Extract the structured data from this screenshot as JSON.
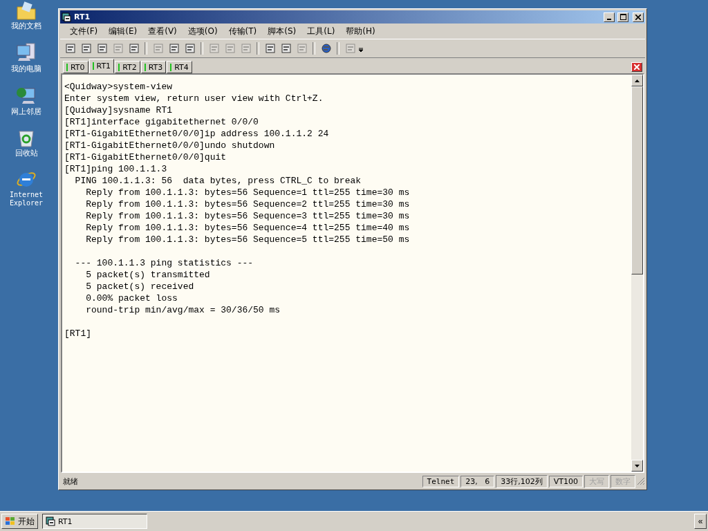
{
  "desktop_icons": [
    {
      "label": "我的文档",
      "kind": "folder"
    },
    {
      "label": "我的电脑",
      "kind": "computer"
    },
    {
      "label": "网上邻居",
      "kind": "network"
    },
    {
      "label": "回收站",
      "kind": "recycle"
    },
    {
      "label": "Internet\nExplorer",
      "kind": "browser"
    }
  ],
  "window": {
    "title": "RT1"
  },
  "menu": [
    "文件(F)",
    "编辑(E)",
    "查看(V)",
    "选项(O)",
    "传输(T)",
    "脚本(S)",
    "工具(L)",
    "帮助(H)"
  ],
  "toolbar": [
    {
      "kind": "button",
      "disabled": false
    },
    {
      "kind": "button",
      "disabled": false
    },
    {
      "kind": "button",
      "disabled": false
    },
    {
      "kind": "button",
      "disabled": true
    },
    {
      "kind": "button",
      "disabled": false
    },
    {
      "kind": "separator"
    },
    {
      "kind": "button",
      "disabled": true
    },
    {
      "kind": "button",
      "disabled": false
    },
    {
      "kind": "button",
      "disabled": false
    },
    {
      "kind": "separator"
    },
    {
      "kind": "button",
      "disabled": true
    },
    {
      "kind": "button",
      "disabled": true
    },
    {
      "kind": "button",
      "disabled": true
    },
    {
      "kind": "separator"
    },
    {
      "kind": "button",
      "disabled": false
    },
    {
      "kind": "button",
      "disabled": false
    },
    {
      "kind": "button",
      "disabled": true
    },
    {
      "kind": "separator"
    },
    {
      "kind": "button",
      "disabled": false
    },
    {
      "kind": "separator"
    },
    {
      "kind": "button",
      "disabled": true
    }
  ],
  "tabs": [
    {
      "label": "RT0",
      "selected": false
    },
    {
      "label": "RT1",
      "selected": true
    },
    {
      "label": "RT2",
      "selected": false
    },
    {
      "label": "RT3",
      "selected": false
    },
    {
      "label": "RT4",
      "selected": false
    }
  ],
  "terminal_blocks": [
    [
      "<Quidway>system-view",
      "Enter system view, return user view with Ctrl+Z.",
      "[Quidway]sysname RT1",
      "[RT1]interface gigabitethernet 0/0/0",
      "[RT1-GigabitEthernet0/0/0]ip address 100.1.1.2 24",
      "[RT1-GigabitEthernet0/0/0]undo shutdown",
      "[RT1-GigabitEthernet0/0/0]quit",
      "[RT1]ping 100.1.1.3",
      "  PING 100.1.1.3: 56  data bytes, press CTRL_C to break",
      "    Reply from 100.1.1.3: bytes=56 Sequence=1 ttl=255 time=30 ms",
      "    Reply from 100.1.1.3: bytes=56 Sequence=2 ttl=255 time=30 ms",
      "    Reply from 100.1.1.3: bytes=56 Sequence=3 ttl=255 time=30 ms",
      "    Reply from 100.1.1.3: bytes=56 Sequence=4 ttl=255 time=40 ms",
      "    Reply from 100.1.1.3: bytes=56 Sequence=5 ttl=255 time=50 ms"
    ],
    [
      "  --- 100.1.1.3 ping statistics ---",
      "    5 packet(s) transmitted",
      "    5 packet(s) received",
      "    0.00% packet loss",
      "    round-trip min/avg/max = 30/36/50 ms"
    ],
    [
      "[RT1]"
    ]
  ],
  "status_bar": {
    "message": "就绪",
    "segments": [
      {
        "text": "Telnet",
        "disabled": false
      },
      {
        "text": "23,   6",
        "disabled": false
      },
      {
        "text": "33行,102列",
        "disabled": false
      },
      {
        "text": "VT100",
        "disabled": false
      },
      {
        "text": "大写",
        "disabled": true
      },
      {
        "text": "数字",
        "disabled": true
      }
    ]
  },
  "taskbar": {
    "start": "开始",
    "tasks": [
      {
        "label": "RT1",
        "selected": true
      }
    ],
    "chevron": "«"
  }
}
